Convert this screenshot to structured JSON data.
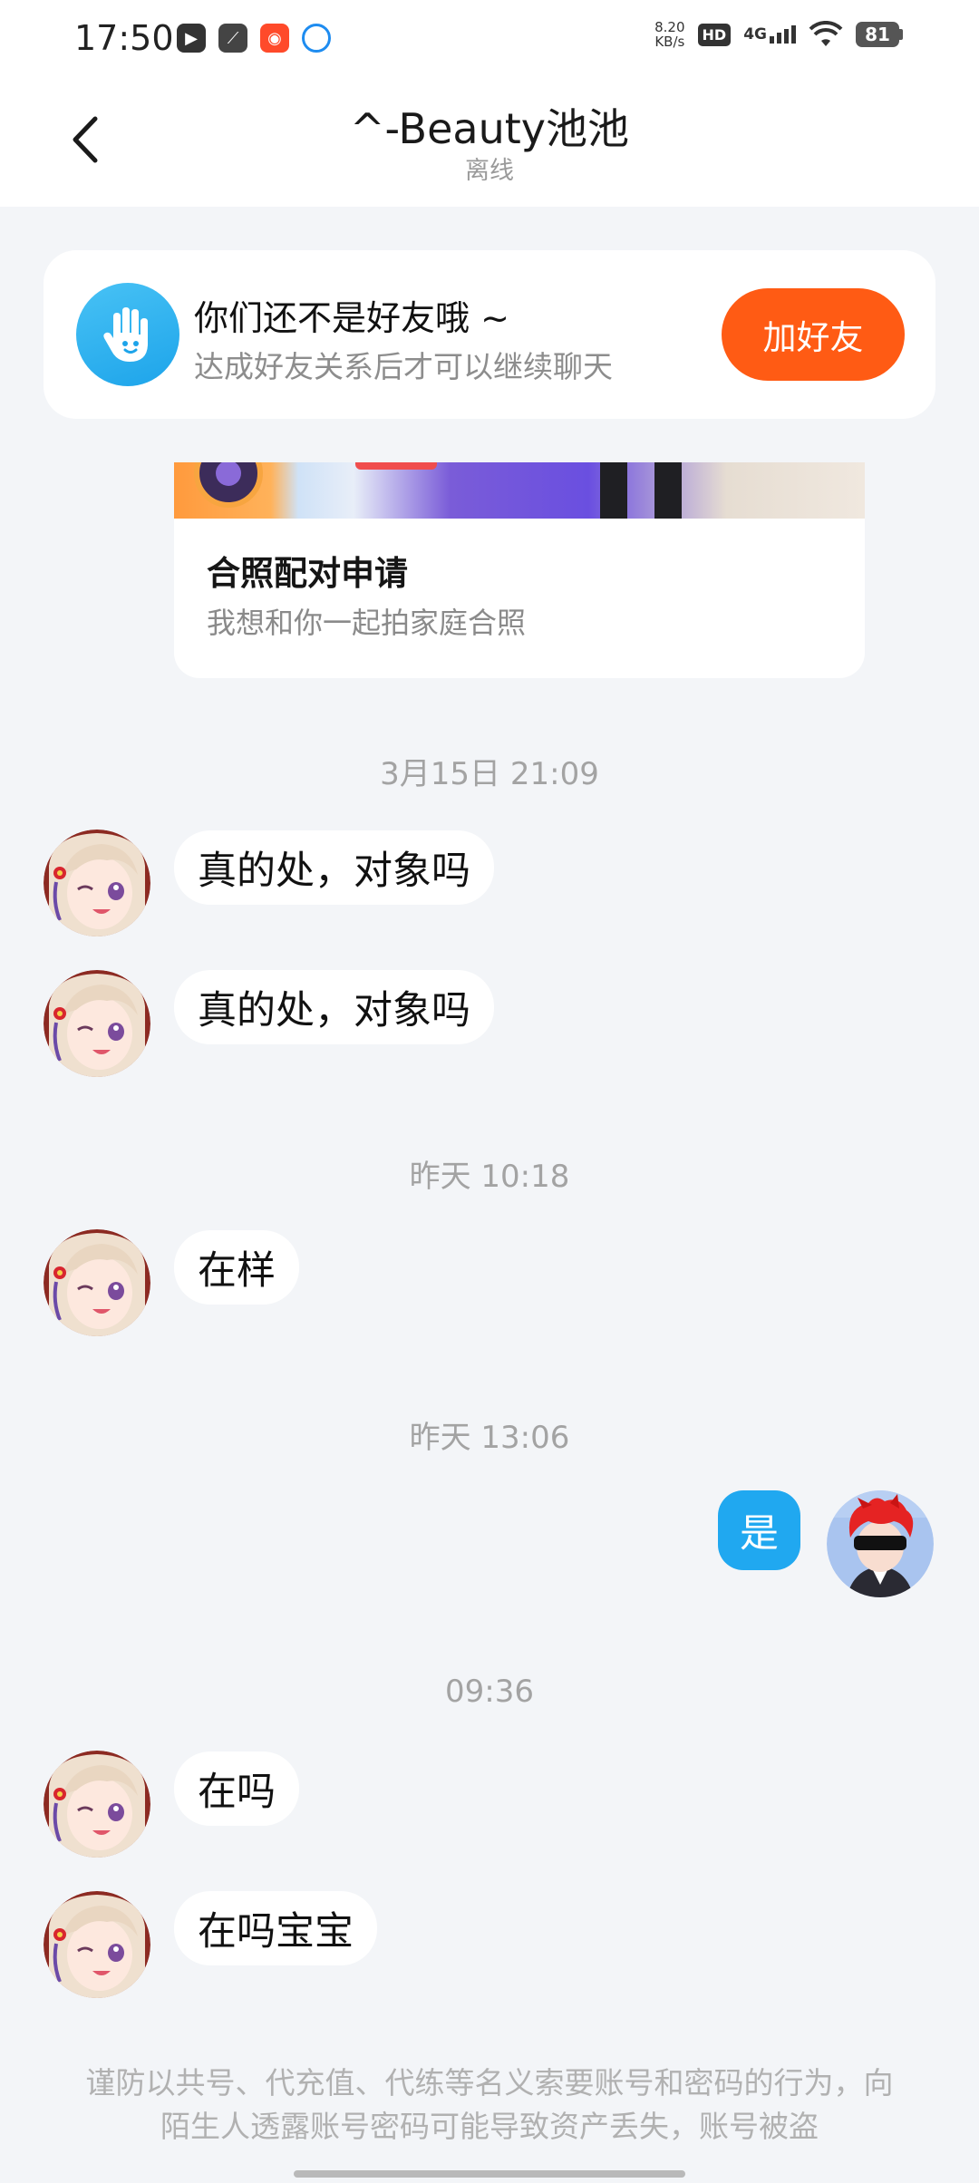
{
  "status_bar": {
    "time": "17:50",
    "net_speed_value": "8.20",
    "net_speed_unit": "KB/s",
    "hd_label": "HD",
    "network_label": "4G",
    "battery": "81"
  },
  "header": {
    "title": "^-Beauty池池",
    "status": "离线"
  },
  "friend_banner": {
    "title": "你们还不是好友哦 ~",
    "subtitle": "达成好友关系后才可以继续聊天",
    "button": "加好友"
  },
  "invite_card": {
    "title": "合照配对申请",
    "subtitle": "我想和你一起拍家庭合照"
  },
  "messages": [
    {
      "type": "time",
      "text": "3月15日 21:09"
    },
    {
      "type": "in",
      "text": "真的处，对象吗"
    },
    {
      "type": "in",
      "text": "真的处，对象吗"
    },
    {
      "type": "time",
      "text": "昨天 10:18"
    },
    {
      "type": "in",
      "text": "在样"
    },
    {
      "type": "time",
      "text": "昨天 13:06"
    },
    {
      "type": "out",
      "text": "是"
    },
    {
      "type": "time",
      "text": "09:36"
    },
    {
      "type": "in",
      "text": "在吗"
    },
    {
      "type": "in",
      "text": "在吗宝宝"
    }
  ],
  "warning": "谨防以共号、代充值、代练等名义索要账号和密码的行为，向陌生人透露账号密码可能导致资产丢失，账号被盗",
  "colors": {
    "accent_blue": "#20a8f0",
    "add_friend_orange": "#ff5b14",
    "background": "#f3f5f8"
  }
}
